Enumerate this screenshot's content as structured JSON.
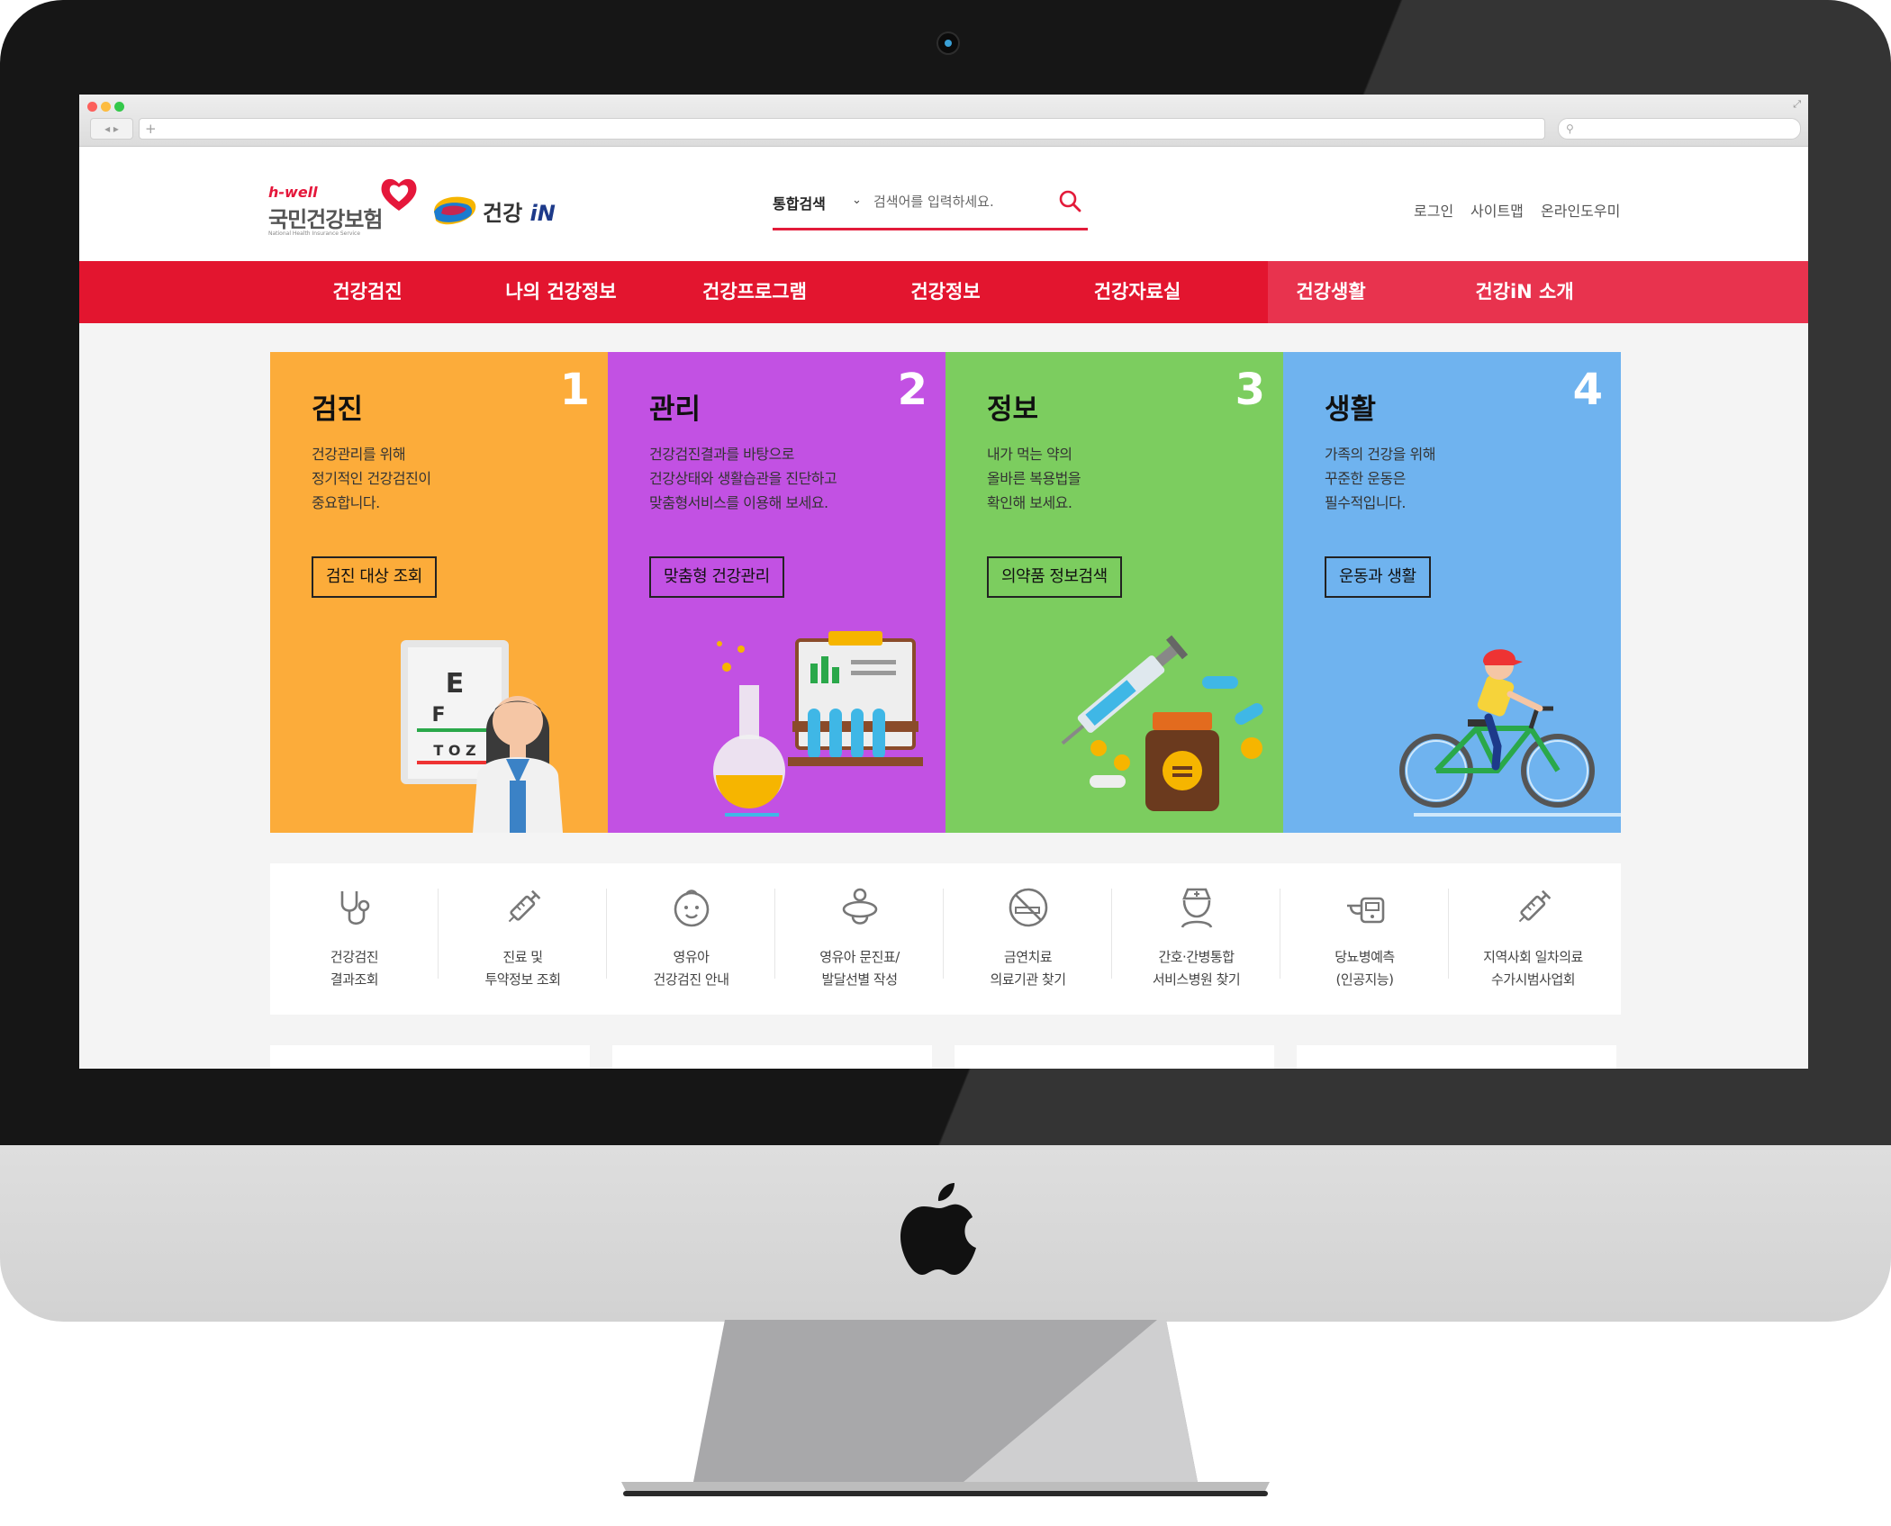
{
  "header": {
    "logo_nhis": {
      "brand": "h-well",
      "name": "국민건강보험",
      "english": "National Health Insurance Service"
    },
    "logo_gin": {
      "name": "건강",
      "suffix": "iN"
    },
    "search": {
      "category": "통합검색",
      "placeholder": "검색어를 입력하세요."
    },
    "util_links": [
      "로그인",
      "사이트맵",
      "온라인도우미"
    ]
  },
  "nav": {
    "items": [
      "건강검진",
      "나의 건강정보",
      "건강프로그램",
      "건강정보",
      "건강자료실",
      "건강생활",
      "건강iN 소개"
    ]
  },
  "panels": [
    {
      "number": "1",
      "title": "검진",
      "desc": "건강관리를 위해\n정기적인 건강검진이\n중요합니다.",
      "button": "검진 대상 조회",
      "color": "#fcac3a"
    },
    {
      "number": "2",
      "title": "관리",
      "desc": "건강검진결과를 바탕으로\n건강상태와 생활습관을 진단하고\n맞춤형서비스를 이용해 보세요.",
      "button": "맞춤형 건강관리",
      "color": "#c251e3"
    },
    {
      "number": "3",
      "title": "정보",
      "desc": "내가 먹는 약의\n올바른 복용법을\n확인해 보세요.",
      "button": "의약품 정보검색",
      "color": "#7ccd5f"
    },
    {
      "number": "4",
      "title": "생활",
      "desc": "가족의 건강을 위해\n꾸준한 운동은\n필수적입니다.",
      "button": "운동과 생활",
      "color": "#6fb3ef"
    }
  ],
  "quick_links": [
    {
      "label": "건강검진\n결과조회",
      "icon": "stethoscope-icon"
    },
    {
      "label": "진료 및\n투약정보 조회",
      "icon": "syringe-icon"
    },
    {
      "label": "영유아\n건강검진 안내",
      "icon": "baby-face-icon"
    },
    {
      "label": "영유아 문진표/\n발달선별 작성",
      "icon": "pacifier-icon"
    },
    {
      "label": "금연치료\n의료기관 찾기",
      "icon": "no-smoking-icon"
    },
    {
      "label": "간호·간병통합\n서비스병원 찾기",
      "icon": "nurse-icon"
    },
    {
      "label": "당뇨병예측\n(인공지능)",
      "icon": "glucose-meter-icon"
    },
    {
      "label": "지역사회 일차의료\n수가시범사업회",
      "icon": "syringe-icon"
    }
  ],
  "colors": {
    "brand_red": "#e3152f",
    "accent_blue": "#1d3a8a"
  }
}
